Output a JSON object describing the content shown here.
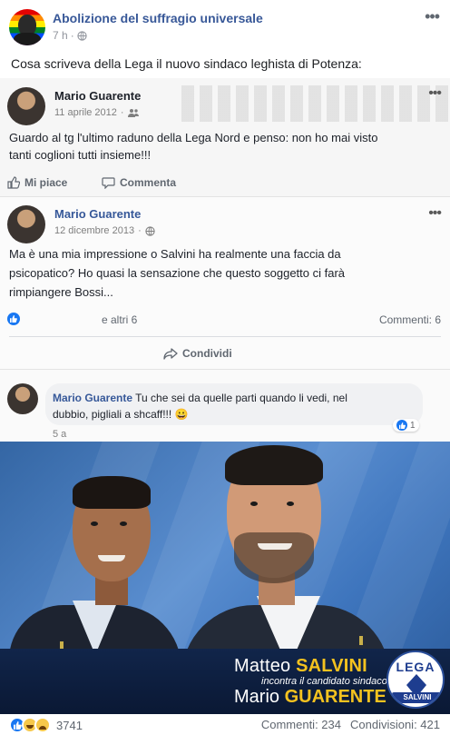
{
  "post": {
    "page_name": "Abolizione del suffragio universale",
    "time": "7 h",
    "meta_sep": "·",
    "more": "•••",
    "text": "Cosa scriveva della Lega il nuovo sindaco leghista di Potenza:"
  },
  "screenshot": {
    "card1": {
      "name": "Mario Guarente",
      "date": "11 aprile 2012",
      "sep": "·",
      "text_lines": [
        "Guardo al tg l'ultimo raduno della Lega Nord e penso: non ho mai visto",
        "tanti coglioni tutti insieme!!!"
      ],
      "like_label": "Mi piace",
      "comment_label": "Commenta",
      "more": "•••"
    },
    "card2": {
      "name": "Mario Guarente",
      "date": "12 dicembre 2013",
      "sep": "·",
      "text_lines": [
        "Ma è una mia impressione o Salvini ha realmente una faccia da",
        "psicopatico? Ho quasi la sensazione che questo soggetto ci farà",
        "rimpiangere Bossi..."
      ],
      "reactions_others": "e altri 6",
      "comments_count": "Commenti: 6",
      "share_label": "Condividi",
      "more": "•••"
    },
    "comment": {
      "author": "Mario Guarente",
      "text_line1": "Tu che sei da quelle parti quando li vedi, nel",
      "text_line2": "dubbio, pigliali a shcaff!!! 😀",
      "reaction_count": "1",
      "age": "5 a"
    },
    "photo": {
      "banner_line1_plain": "Matteo",
      "banner_line1_bold": "SALVINI",
      "banner_line2": "incontra il candidato sindaco",
      "banner_line3_plain": "Mario",
      "banner_line3_bold": "GUARENTE",
      "logo_top": "LEGA",
      "logo_band": "SALVINI"
    }
  },
  "footer": {
    "reactions": [
      "like",
      "haha",
      "sad"
    ],
    "reactions_count": "3741",
    "comments": "Commenti: 234",
    "shares": "Condivisioni: 421"
  },
  "colors": {
    "link_blue": "#385898",
    "fb_blue": "#1877f2",
    "banner_yellow": "#f4c21f",
    "banner_navy": "#11254a"
  }
}
